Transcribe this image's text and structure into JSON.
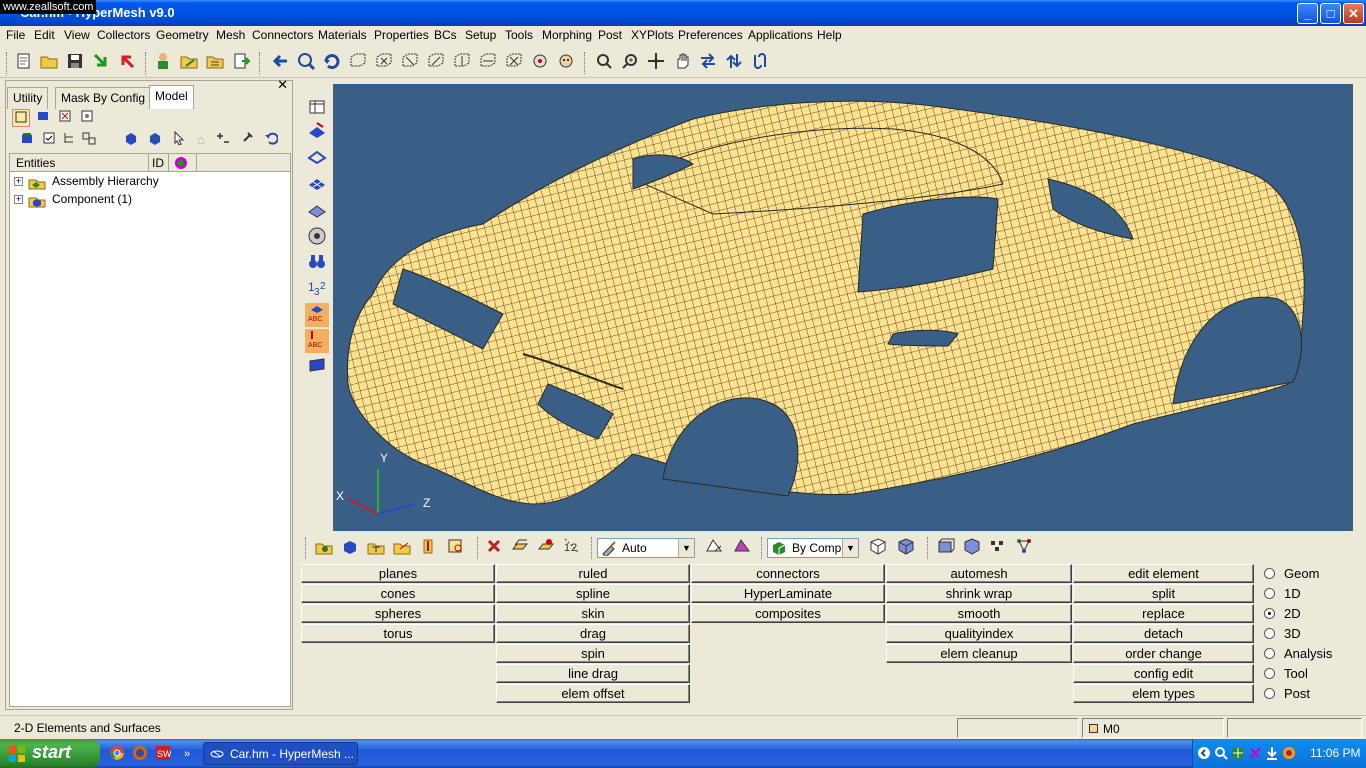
{
  "window": {
    "title": "Car.hm - HyperMesh v9.0",
    "watermark": "www.zeallsoft.com",
    "minimize": "_",
    "maximize": "□",
    "close": "✕"
  },
  "menu": [
    "File",
    "Edit",
    "View",
    "Collectors",
    "Geometry",
    "Mesh",
    "Connectors",
    "Materials",
    "Properties",
    "BCs",
    "Setup",
    "Tools",
    "Morphing",
    "Post",
    "XYPlots",
    "Preferences",
    "Applications",
    "Help"
  ],
  "left_panel": {
    "close": "✕",
    "tabs": [
      "Utility",
      "Mask By Config",
      "Model"
    ],
    "active_tab": "Model",
    "columns": [
      "Entities",
      "ID"
    ],
    "tree": [
      {
        "label": "Assembly Hierarchy",
        "expander": "+"
      },
      {
        "label": "Component (1)",
        "expander": "+"
      }
    ]
  },
  "bottom_toolbar": {
    "element_color_mode": "Auto",
    "display_mode": "By Comp"
  },
  "panel": {
    "columns": [
      [
        "planes",
        "cones",
        "spheres",
        "torus"
      ],
      [
        "ruled",
        "spline",
        "skin",
        "drag",
        "spin",
        "line drag",
        "elem offset"
      ],
      [
        "connectors",
        "HyperLaminate",
        "composites"
      ],
      [
        "automesh",
        "shrink wrap",
        "smooth",
        "qualityindex",
        "elem cleanup"
      ],
      [
        "edit element",
        "split",
        "replace",
        "detach",
        "order change",
        "config edit",
        "elem types"
      ]
    ],
    "pages": [
      "Geom",
      "1D",
      "2D",
      "3D",
      "Analysis",
      "Tool",
      "Post"
    ],
    "selected_page": "2D"
  },
  "viewport": {
    "axes": {
      "x": "X",
      "y": "Y",
      "z": "Z"
    },
    "background": "#3a5f86",
    "mesh_color": "#ffe08c"
  },
  "status": {
    "message": "2-D Elements and Surfaces",
    "component": "M0"
  },
  "taskbar": {
    "start": "start",
    "task": "Car.hm - HyperMesh ...",
    "time": "11:06 PM",
    "overflow": "»"
  }
}
